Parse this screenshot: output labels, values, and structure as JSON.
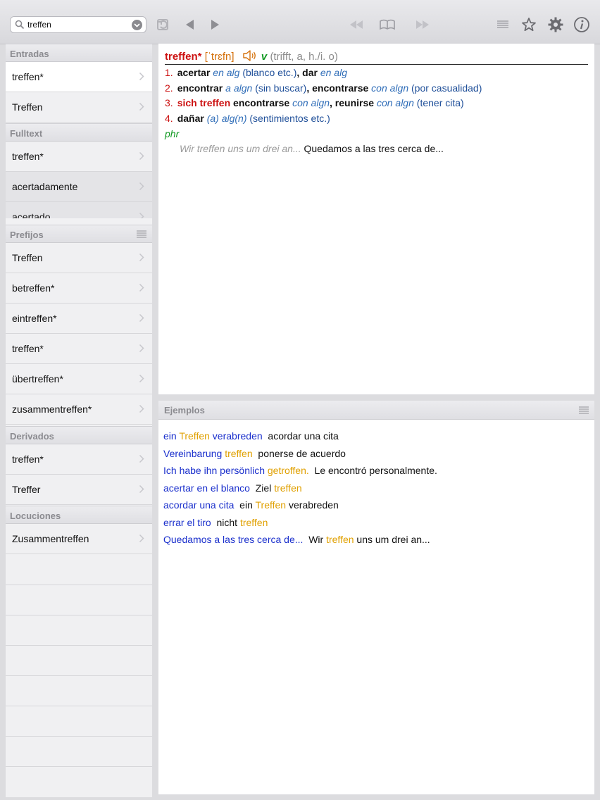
{
  "toolbar": {
    "search_value": "treffen",
    "icons": [
      "search-icon",
      "clear-icon",
      "sync-icon",
      "back-icon",
      "forward-icon",
      "first-icon",
      "book-icon",
      "last-icon",
      "list-icon",
      "star-icon",
      "gear-icon",
      "info-icon"
    ]
  },
  "sidebar": {
    "entradas": {
      "header": "Entradas",
      "items": [
        {
          "label": "treffen*"
        },
        {
          "label": "Treffen"
        }
      ]
    },
    "fulltext": {
      "header": "Fulltext",
      "items": [
        {
          "label": "treffen*"
        },
        {
          "label": "acertadamente"
        },
        {
          "label": "acertado"
        }
      ]
    },
    "prefijos": {
      "header": "Prefijos",
      "items": [
        {
          "label": "Treffen"
        },
        {
          "label": "betreffen*"
        },
        {
          "label": "eintreffen*"
        },
        {
          "label": "treffen*"
        },
        {
          "label": "übertreffen*"
        },
        {
          "label": "zusammentreffen*"
        }
      ]
    },
    "derivados": {
      "header": "Derivados",
      "items": [
        {
          "label": "treffen*"
        },
        {
          "label": "Treffer"
        }
      ]
    },
    "locuciones": {
      "header": "Locuciones",
      "items": [
        {
          "label": "Zusammentreffen"
        }
      ]
    }
  },
  "entry": {
    "headword": "treffen*",
    "ipa": "[ˈtrɛfn]",
    "pos": "v",
    "grammar": "(trifft, a, h./i. o)",
    "senses": [
      {
        "num": "1.",
        "parts": [
          [
            "b",
            "acertar"
          ],
          [
            "sp",
            " "
          ],
          [
            "it",
            "en alg"
          ],
          [
            "pl",
            " (blanco etc.)"
          ],
          [
            "b",
            ", dar"
          ],
          [
            "sp",
            " "
          ],
          [
            "it",
            "en alg"
          ]
        ]
      },
      {
        "num": "2.",
        "parts": [
          [
            "b",
            "encontrar"
          ],
          [
            "sp",
            " "
          ],
          [
            "it",
            "a algn"
          ],
          [
            "pl",
            " (sin buscar)"
          ],
          [
            "b",
            ", encontrarse"
          ],
          [
            "sp",
            " "
          ],
          [
            "it",
            "con algn"
          ],
          [
            "pl",
            " (por casualidad)"
          ]
        ]
      },
      {
        "num": "3.",
        "parts": [
          [
            "br",
            "sich treffen"
          ],
          [
            "b",
            " encontrarse"
          ],
          [
            "sp",
            " "
          ],
          [
            "it",
            "con algn"
          ],
          [
            "b",
            ", reunirse"
          ],
          [
            "sp",
            " "
          ],
          [
            "it",
            "con algn"
          ],
          [
            "pl",
            " (tener cita)"
          ]
        ]
      },
      {
        "num": "4.",
        "parts": [
          [
            "b",
            "dañar"
          ],
          [
            "sp",
            " "
          ],
          [
            "it",
            "(a) alg(n)"
          ],
          [
            "pl",
            " (sentimientos etc.)"
          ]
        ]
      }
    ],
    "phrase_label": "phr",
    "phrase_de": "Wir treffen uns um drei an...",
    "phrase_es": "Quedamos a las tres cerca de..."
  },
  "examples": {
    "header": "Ejemplos",
    "lines": [
      [
        [
          "blue",
          "ein "
        ],
        [
          "orange",
          "Treffen"
        ],
        [
          "blue",
          " verabreden"
        ],
        [
          "blk",
          "  acordar una cita"
        ]
      ],
      [
        [
          "blue",
          "Vereinbarung "
        ],
        [
          "orange",
          "treffen"
        ],
        [
          "blk",
          "  ponerse de acuerdo"
        ]
      ],
      [
        [
          "blue",
          "Ich habe ihn persönlich "
        ],
        [
          "orange",
          "getroffen."
        ],
        [
          "blk",
          "  Le encontró personalmente."
        ]
      ],
      [
        [
          "blue",
          "acertar en el blanco"
        ],
        [
          "blk",
          "  Ziel "
        ],
        [
          "orange",
          "treffen"
        ]
      ],
      [
        [
          "blue",
          "acordar una cita"
        ],
        [
          "blk",
          "  ein "
        ],
        [
          "orange",
          "Treffen"
        ],
        [
          "blk",
          " verabreden"
        ]
      ],
      [
        [
          "blue",
          "errar el tiro"
        ],
        [
          "blk",
          "  nicht "
        ],
        [
          "orange",
          "treffen"
        ]
      ],
      [
        [
          "blue",
          "Quedamos a las tres cerca de..."
        ],
        [
          "blk",
          "  Wir "
        ],
        [
          "orange",
          "treffen"
        ],
        [
          "blk",
          " uns um drei an..."
        ]
      ]
    ]
  }
}
